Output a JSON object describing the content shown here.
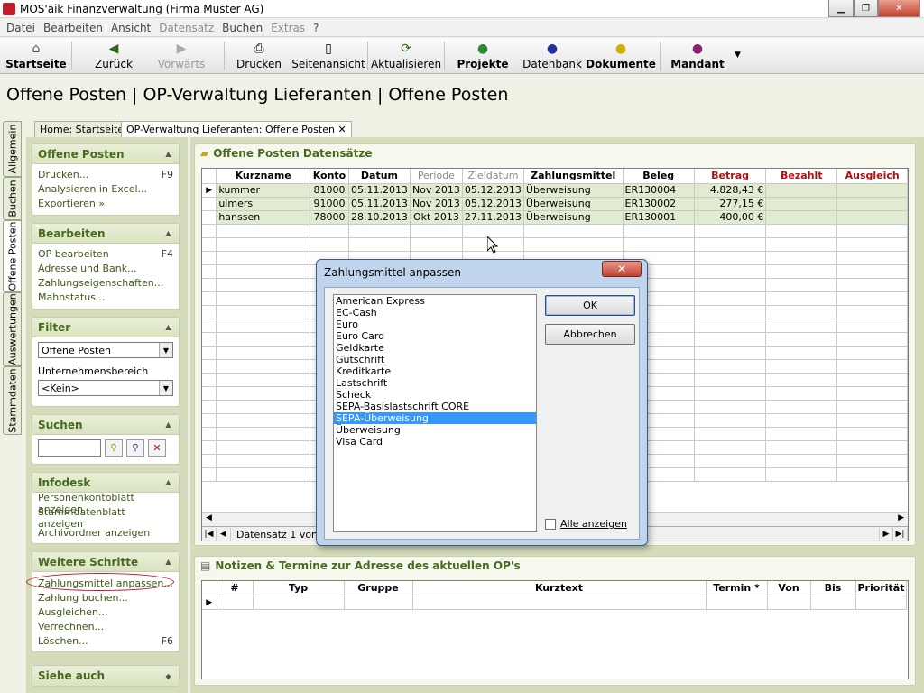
{
  "window": {
    "title": "MOS'aik Finanzverwaltung (Firma Muster AG)"
  },
  "menu": [
    {
      "label": "Datei",
      "enabled": true
    },
    {
      "label": "Bearbeiten",
      "enabled": true
    },
    {
      "label": "Ansicht",
      "enabled": true
    },
    {
      "label": "Datensatz",
      "enabled": false
    },
    {
      "label": "Buchen",
      "enabled": true
    },
    {
      "label": "Extras",
      "enabled": false
    },
    {
      "label": "?",
      "enabled": true
    }
  ],
  "toolbar": {
    "start": "Startseite",
    "back": "Zurück",
    "forward": "Vorwärts",
    "print": "Drucken",
    "page_view": "Seitenansicht",
    "refresh": "Aktualisieren",
    "projects": "Projekte",
    "database": "Datenbank",
    "documents": "Dokumente",
    "client": "Mandant"
  },
  "page_title": "Offene Posten | OP-Verwaltung Lieferanten | Offene Posten",
  "vtabs": [
    "Allgemein",
    "Buchen",
    "Offene Posten",
    "Auswertungen",
    "Stammdaten"
  ],
  "doc_tabs": [
    "Home: Startseite",
    "OP-Verwaltung Lieferanten: Offene Posten"
  ],
  "left": {
    "offene_posten": {
      "title": "Offene Posten",
      "items": [
        {
          "label": "Drucken...",
          "key": "F9"
        },
        {
          "label": "Analysieren in Excel...",
          "key": ""
        },
        {
          "label": "Exportieren »",
          "key": ""
        }
      ]
    },
    "bearbeiten": {
      "title": "Bearbeiten",
      "items": [
        {
          "label": "OP bearbeiten",
          "key": "F4"
        },
        {
          "label": "Adresse und Bank...",
          "key": ""
        },
        {
          "label": "Zahlungseigenschaften...",
          "key": ""
        },
        {
          "label": "Mahnstatus...",
          "key": ""
        }
      ]
    },
    "filter": {
      "title": "Filter",
      "select1": "Offene Posten",
      "label": "Unternehmensbereich",
      "select2": "<Kein>"
    },
    "suchen": {
      "title": "Suchen",
      "value": ""
    },
    "infodesk": {
      "title": "Infodesk",
      "items": [
        {
          "label": "Personenkontoblatt anzeigen"
        },
        {
          "label": "Stammdatenblatt anzeigen"
        },
        {
          "label": "Archivordner anzeigen"
        }
      ]
    },
    "weitere": {
      "title": "Weitere Schritte",
      "items": [
        {
          "label": "Zahlungsmittel anpassen...",
          "key": ""
        },
        {
          "label": "Zahlung buchen...",
          "key": ""
        },
        {
          "label": "Ausgleichen...",
          "key": ""
        },
        {
          "label": "Verrechnen...",
          "key": ""
        },
        {
          "label": "Löschen...",
          "key": "F6"
        }
      ]
    },
    "siehe_auch": {
      "title": "Siehe auch"
    }
  },
  "op_panel": {
    "title": "Offene Posten Datensätze",
    "columns": [
      "Kurzname",
      "Konto",
      "Datum",
      "Periode",
      "Zieldatum",
      "Zahlungsmittel",
      "Beleg",
      "Betrag",
      "Bezahlt",
      "Ausgleich"
    ],
    "rows": [
      [
        "kummer",
        "81000",
        "05.11.2013",
        "Nov 2013",
        "05.12.2013",
        "Überweisung",
        "ER130004",
        "4.828,43 €",
        "",
        ""
      ],
      [
        "ulmers",
        "91000",
        "05.11.2013",
        "Nov 2013",
        "05.12.2013",
        "Überweisung",
        "ER130002",
        "277,15 €",
        "",
        ""
      ],
      [
        "hanssen",
        "78000",
        "28.10.2013",
        "Okt 2013",
        "27.11.2013",
        "Überweisung",
        "ER130001",
        "400,00 €",
        "",
        ""
      ]
    ],
    "nav_text": "Datensatz 1 von 3"
  },
  "notes_panel": {
    "title": "Notizen & Termine zur Adresse des aktuellen OP's",
    "columns": [
      "#",
      "Typ",
      "Gruppe",
      "Kurztext",
      "Termin *",
      "Von",
      "Bis",
      "Priorität"
    ]
  },
  "dialog": {
    "title": "Zahlungsmittel anpassen",
    "options": [
      "American Express",
      "EC-Cash",
      "Euro",
      "Euro Card",
      "Geldkarte",
      "Gutschrift",
      "Kreditkarte",
      "Lastschrift",
      "Scheck",
      "SEPA-Basislastschrift CORE",
      "SEPA-Überweisung",
      "Überweisung",
      "Visa Card"
    ],
    "selected": "SEPA-Überweisung",
    "ok": "OK",
    "cancel": "Abbrechen",
    "show_all": "Alle anzeigen"
  },
  "colors": {
    "accent_green": "#476a1f",
    "panel_bg": "#d4dcbc",
    "row_green": "#e1ebd0",
    "selection": "#3399ff"
  }
}
